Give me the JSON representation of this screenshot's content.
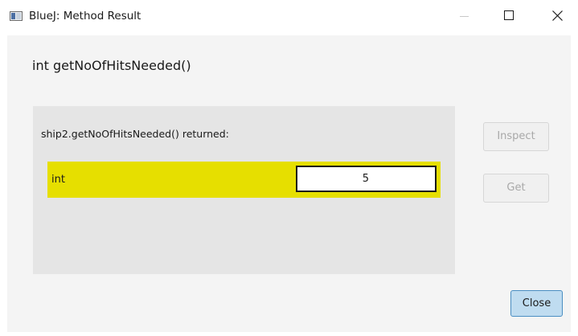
{
  "window": {
    "title": "BlueJ:  Method Result",
    "controls": {
      "minimize_icon": "minimize-icon",
      "maximize_icon": "maximize-icon",
      "close_icon": "close-icon"
    }
  },
  "dialog": {
    "method_signature": "int getNoOfHitsNeeded()",
    "returned_label": "ship2.getNoOfHitsNeeded() returned:",
    "result": {
      "type": "int",
      "value": "5"
    },
    "buttons": {
      "inspect": "Inspect",
      "get": "Get",
      "close": "Close"
    }
  },
  "colors": {
    "result_highlight": "#e6df00",
    "panel_background": "#e5e5e5",
    "close_button_fill": "#bfdcf0",
    "close_button_border": "#4a8ec2",
    "disabled_text": "#a8a8a8"
  }
}
